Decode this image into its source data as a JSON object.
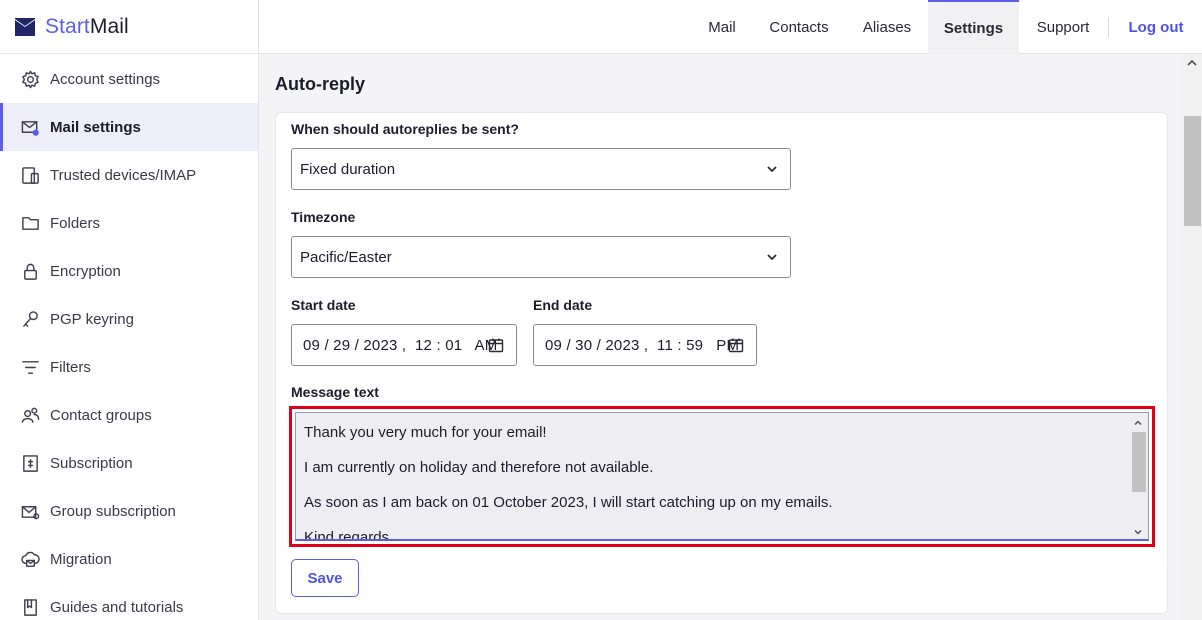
{
  "brand": {
    "part1": "Start",
    "part2": "Mail"
  },
  "sidebar": {
    "items": [
      {
        "label": "Account settings",
        "icon": "gear-icon"
      },
      {
        "label": "Mail settings",
        "icon": "mail-gear-icon",
        "active": true
      },
      {
        "label": "Trusted devices/IMAP",
        "icon": "devices-icon"
      },
      {
        "label": "Folders",
        "icon": "folder-icon"
      },
      {
        "label": "Encryption",
        "icon": "lock-icon"
      },
      {
        "label": "PGP keyring",
        "icon": "key-icon"
      },
      {
        "label": "Filters",
        "icon": "filter-icon"
      },
      {
        "label": "Contact groups",
        "icon": "contact-groups-icon"
      },
      {
        "label": "Subscription",
        "icon": "subscription-icon"
      },
      {
        "label": "Group subscription",
        "icon": "group-mail-icon"
      },
      {
        "label": "Migration",
        "icon": "cloud-mail-icon"
      },
      {
        "label": "Guides and tutorials",
        "icon": "book-icon"
      }
    ]
  },
  "topnav": {
    "items": [
      "Mail",
      "Contacts",
      "Aliases",
      "Settings",
      "Support"
    ],
    "active": "Settings",
    "logout": "Log out"
  },
  "page": {
    "title": "Auto-reply"
  },
  "form": {
    "when_label": "When should autoreplies be sent?",
    "when_value": "Fixed duration",
    "timezone_label": "Timezone",
    "timezone_value": "Pacific/Easter",
    "start_label": "Start date",
    "start_value": "09 / 29 / 2023 ,  12 : 01   AM",
    "end_label": "End date",
    "end_value": "09 / 30 / 2023 ,  11 : 59   PM",
    "message_label": "Message text",
    "message_lines": [
      "Thank you very much for your email!",
      "I am currently on holiday and therefore not available.",
      "As soon as I am back on 01 October 2023, I will start catching up on my emails.",
      "Kind regards,"
    ],
    "save_label": "Save"
  },
  "colors": {
    "accent": "#5a5fe6",
    "highlight": "#e0001a"
  }
}
